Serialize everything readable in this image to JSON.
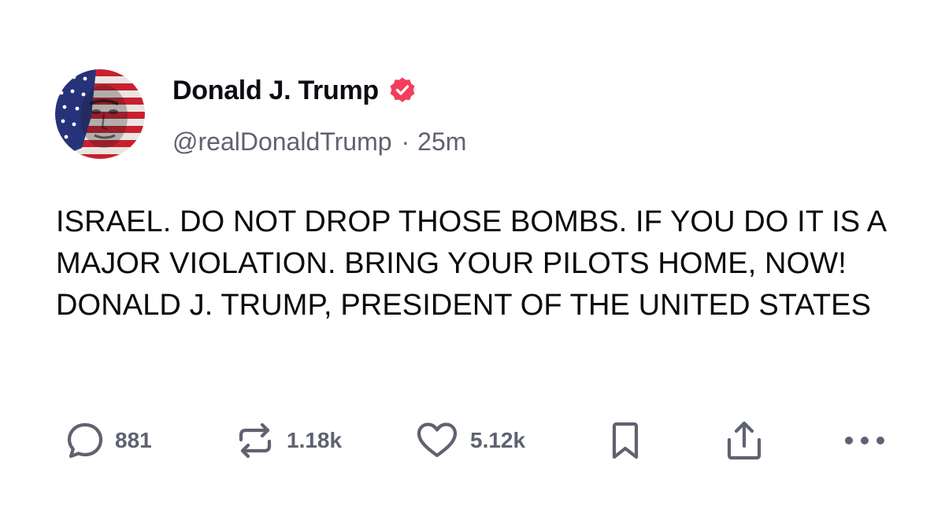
{
  "author": {
    "display_name": "Donald J. Trump",
    "handle": "@realDonaldTrump",
    "separator": "·",
    "time_ago": "25m",
    "verified_icon": "verified-badge-icon",
    "avatar_icon": "flag-portrait-avatar"
  },
  "post": {
    "text": "ISRAEL. DO NOT DROP THOSE BOMBS. IF YOU DO IT IS A MAJOR VIOLATION. BRING YOUR PILOTS HOME, NOW!  DONALD J. TRUMP, PRESIDENT OF THE UNITED STATES"
  },
  "actions": {
    "reply": {
      "icon": "speech-bubble-icon",
      "count": "881"
    },
    "retruth": {
      "icon": "repost-arrows-icon",
      "count": "1.18k"
    },
    "like": {
      "icon": "heart-icon",
      "count": "5.12k"
    },
    "bookmark": {
      "icon": "bookmark-icon"
    },
    "share": {
      "icon": "share-upload-icon"
    },
    "more": {
      "icon": "more-dots-icon"
    }
  },
  "colors": {
    "text_primary": "#0a0a0f",
    "text_secondary": "#5f6270",
    "verified_badge": "#f33e5b",
    "background": "#ffffff"
  }
}
